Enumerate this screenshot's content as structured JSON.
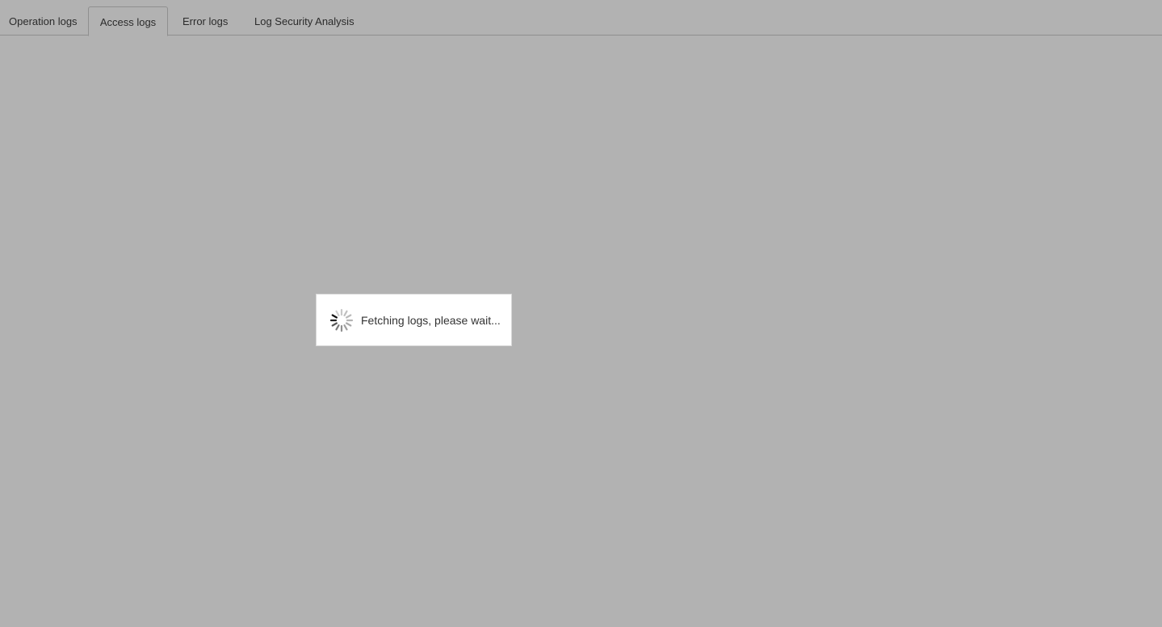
{
  "tabs": [
    {
      "label": "Operation logs",
      "active": false
    },
    {
      "label": "Access logs",
      "active": true
    },
    {
      "label": "Error logs",
      "active": false
    },
    {
      "label": "Log Security Analysis",
      "active": false
    }
  ],
  "loading": {
    "message": "Fetching logs, please wait...",
    "icon": "spinner-icon"
  },
  "colors": {
    "background": "#b2b2b2",
    "dialog": "#ffffff",
    "text": "#333333"
  }
}
